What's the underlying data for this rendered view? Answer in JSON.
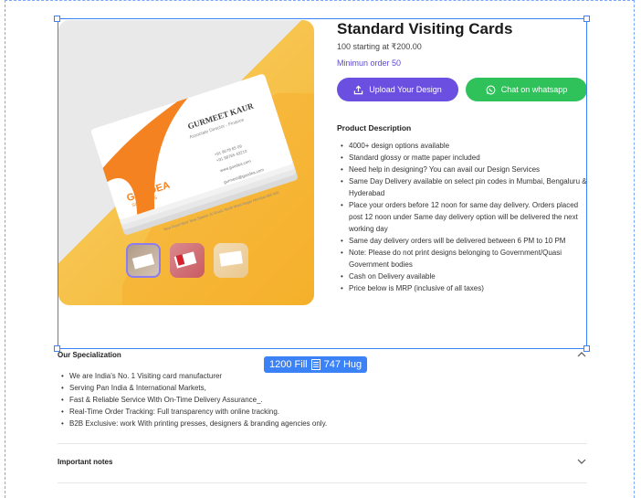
{
  "product": {
    "title": "Standard Visiting Cards",
    "price_line": "100 starting at ₹200.00",
    "min_order": "Minimun order 50",
    "upload_label": "Upload Your Design",
    "whatsapp_label": "Chat on whatsapp",
    "description_title": "Product Description",
    "description_items": [
      "4000+ design options available",
      "Standard glossy or matte paper included",
      "Need help in designing? You can avail our Design Services",
      "Same Day Delivery available on select pin codes in Mumbai, Bengaluru & Hyderabad",
      "Place your orders before 12 noon for same day delivery. Orders placed post 12 noon under Same day delivery option will be delivered the next working day",
      "Same day delivery orders will be delivered between 6 PM to 10 PM",
      "Note: Please do not print designs belonging to Government/Quasi Government bodies",
      "Cash on Delivery available",
      "Price below is MRP (inclusive of all taxes)"
    ]
  },
  "card_mock": {
    "name": "GURMEET KAUR",
    "role": "Associate Director - Finance",
    "logo_text": "GOODEA",
    "logo_sub": "SOLUTIONS",
    "phone1": "+91 9078 65 09",
    "phone2": "+91 98765 43210",
    "web": "www.goodea.com",
    "email": "gurmeet@goodea.com",
    "address": "New Road Near New Station 20 Road, North West Nagar Mumbai 900 000"
  },
  "specialization": {
    "title": "Our Specialization",
    "items": [
      "We are India's No. 1 Visiting card manufacturer",
      "Serving Pan India & International Markets,",
      "Fast & Reliable Service With On-Time Delivery Assurance_.",
      "Real-Time Order Tracking: Full transparency with online tracking.",
      "B2B Exclusive: work With printing presses, designers & branding agencies only."
    ]
  },
  "important_notes": {
    "title": "Important notes"
  },
  "selection": {
    "width_label": "1200 Fill",
    "height_label": "747 Hug"
  },
  "colors": {
    "accent_purple": "#6a4fe0",
    "whatsapp_green": "#2fc15a",
    "selection_blue": "#3b82f6",
    "card_orange": "#f58220"
  },
  "icons": [
    "upload-icon",
    "whatsapp-icon",
    "chevron-up-icon",
    "chevron-down-icon",
    "spacing-icon"
  ]
}
